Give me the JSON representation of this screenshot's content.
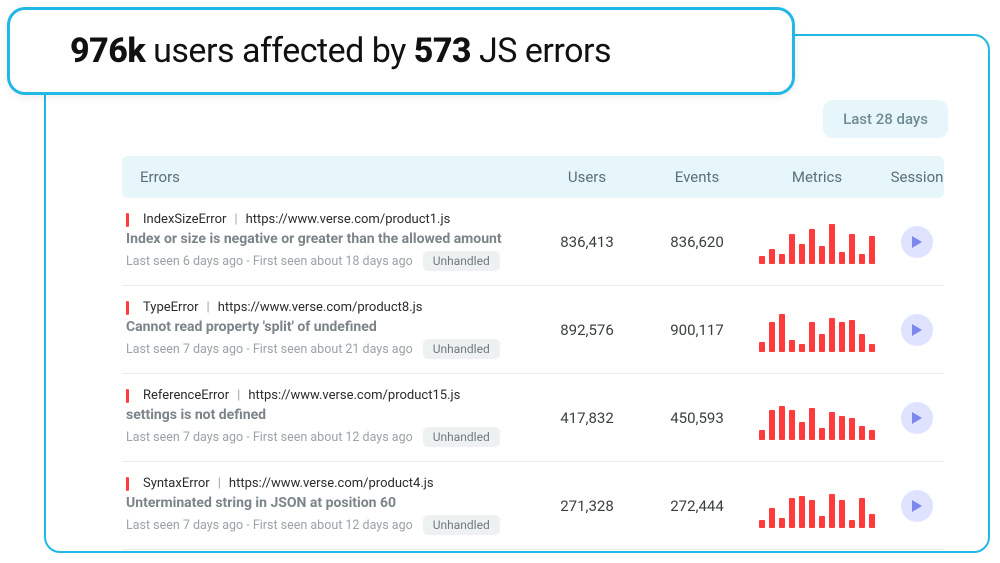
{
  "headline": {
    "users_affected": "976k",
    "mid1": " users affected by ",
    "error_count": "573",
    "mid2": " JS errors"
  },
  "timeframe": {
    "label": "Last 28 days"
  },
  "columns": {
    "errors": "Errors",
    "users": "Users",
    "events": "Events",
    "metrics": "Metrics",
    "session": "Session"
  },
  "badges": {
    "unhandled": "Unhandled"
  },
  "icons": {
    "play": "play-icon"
  },
  "rows": [
    {
      "type": "IndexSizeError",
      "url": "https://www.verse.com/product1.js",
      "message": "Index or size is negative or greater than the allowed amount",
      "seen": "Last seen 6 days ago - First seen about 18 days ago",
      "users": "836,413",
      "events": "836,620",
      "spark": [
        8,
        15,
        10,
        30,
        20,
        35,
        18,
        40,
        12,
        30,
        10,
        28
      ]
    },
    {
      "type": "TypeError",
      "url": "https://www.verse.com/product8.js",
      "message": "Cannot read property 'split' of undefined",
      "seen": "Last seen 7 days ago - First seen about 21 days ago",
      "users": "892,576",
      "events": "900,117",
      "spark": [
        10,
        30,
        38,
        12,
        8,
        30,
        18,
        34,
        30,
        32,
        18,
        8
      ]
    },
    {
      "type": "ReferenceError",
      "url": "https://www.verse.com/product15.js",
      "message": "settings is not defined",
      "seen": "Last seen 7 days ago - First seen about 12 days ago",
      "users": "417,832",
      "events": "450,593",
      "spark": [
        10,
        30,
        34,
        30,
        18,
        32,
        12,
        28,
        24,
        22,
        14,
        10
      ]
    },
    {
      "type": "SyntaxError",
      "url": "https://www.verse.com/product4.js",
      "message": "Unterminated string in JSON at position 60",
      "seen": "Last seen 7 days ago - First seen about 12 days ago",
      "users": "271,328",
      "events": "272,444",
      "spark": [
        8,
        20,
        10,
        30,
        32,
        28,
        12,
        34,
        28,
        8,
        30,
        14
      ]
    }
  ]
}
